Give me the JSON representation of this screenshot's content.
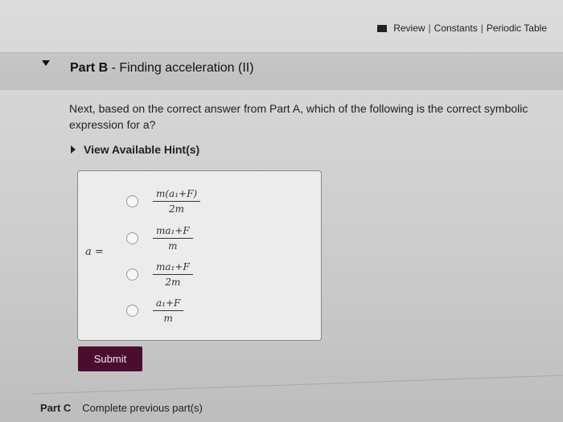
{
  "topbar": {
    "review": "Review",
    "sep1": "|",
    "constants": "Constants",
    "sep2": "|",
    "periodic_table": "Periodic Table"
  },
  "part_b": {
    "label": "Part B",
    "dash": " - ",
    "title": "Finding acceleration (II)"
  },
  "question": {
    "text_line1": "Next, based on the correct answer from Part A, which of the following is the correct symbolic",
    "text_line2": "expression for a?"
  },
  "hint": {
    "label": "View Available Hint(s)"
  },
  "equation_label": "a =",
  "options": [
    {
      "numerator": "m(a₁+F)",
      "denominator": "2m"
    },
    {
      "numerator": "ma₁+F",
      "denominator": "m"
    },
    {
      "numerator": "ma₁+F",
      "denominator": "2m"
    },
    {
      "numerator": "a₁+F",
      "denominator": "m"
    }
  ],
  "submit_label": "Submit",
  "part_c": {
    "label": "Part C",
    "status": "Complete previous part(s)"
  }
}
